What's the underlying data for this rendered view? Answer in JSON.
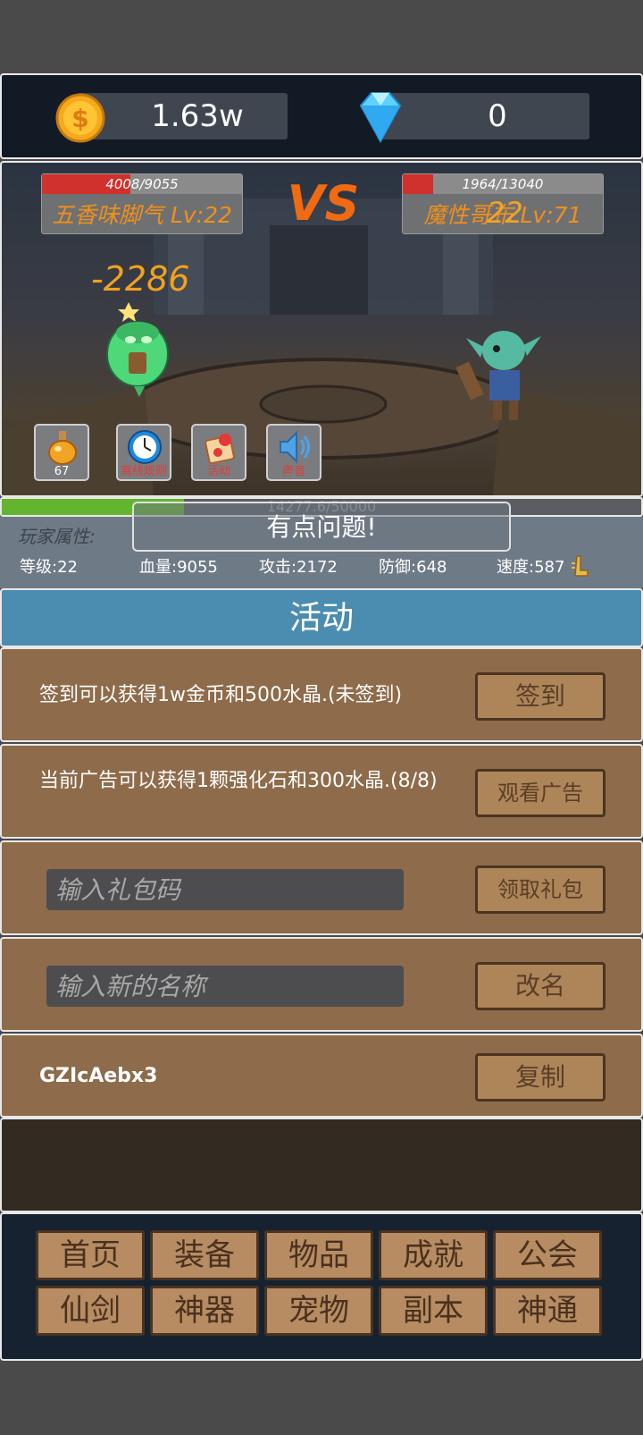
{
  "topbar": {
    "gold": "1.63w",
    "gems": "0"
  },
  "battle": {
    "player": {
      "hp_text": "4008/9055",
      "hp_fraction": 0.443,
      "name": "五香味脚气 Lv:22"
    },
    "enemy": {
      "hp_text": "1964/13040",
      "hp_fraction": 0.151,
      "name": "魔性哥布 Lv:71",
      "overlay_number": "22"
    },
    "vs_text": "VS",
    "damage_text": "-2286",
    "buttons": [
      {
        "label": "67",
        "icon": "potion-icon"
      },
      {
        "label": "离线规则",
        "icon": "clock-icon"
      },
      {
        "label": "活动",
        "icon": "gift-icon"
      },
      {
        "label": "声音",
        "icon": "speaker-icon"
      }
    ]
  },
  "progress": {
    "text": "14277.6/50000",
    "fraction": 0.2855
  },
  "attributes": {
    "title": "玩家属性:",
    "level": "等级:22",
    "hp": "血量:9055",
    "attack": "攻击:2172",
    "defense": "防御:648",
    "speed": "速度:587"
  },
  "toast": "有点问题!",
  "activity": {
    "title": "活动",
    "signin_text": "签到可以获得1w金币和500水晶.(未签到)",
    "signin_button": "签到",
    "ad_text": "当前广告可以获得1颗强化石和300水晶.(8/8)",
    "ad_button": "观看广告",
    "gift_placeholder": "输入礼包码",
    "gift_button": "领取礼包",
    "rename_placeholder": "输入新的名称",
    "rename_button": "改名",
    "player_id": "GZIcAebx3",
    "copy_button": "复制"
  },
  "nav": {
    "row1": [
      "首页",
      "装备",
      "物品",
      "成就",
      "公会"
    ],
    "row2": [
      "仙剑",
      "神器",
      "宠物",
      "副本",
      "神通"
    ]
  },
  "colors": {
    "gold_accent": "#f0901a",
    "hp_red": "#d0312d",
    "progress_green": "#62b52c",
    "activity_blue": "#4a8db1",
    "wood": "#8e6b4a"
  }
}
